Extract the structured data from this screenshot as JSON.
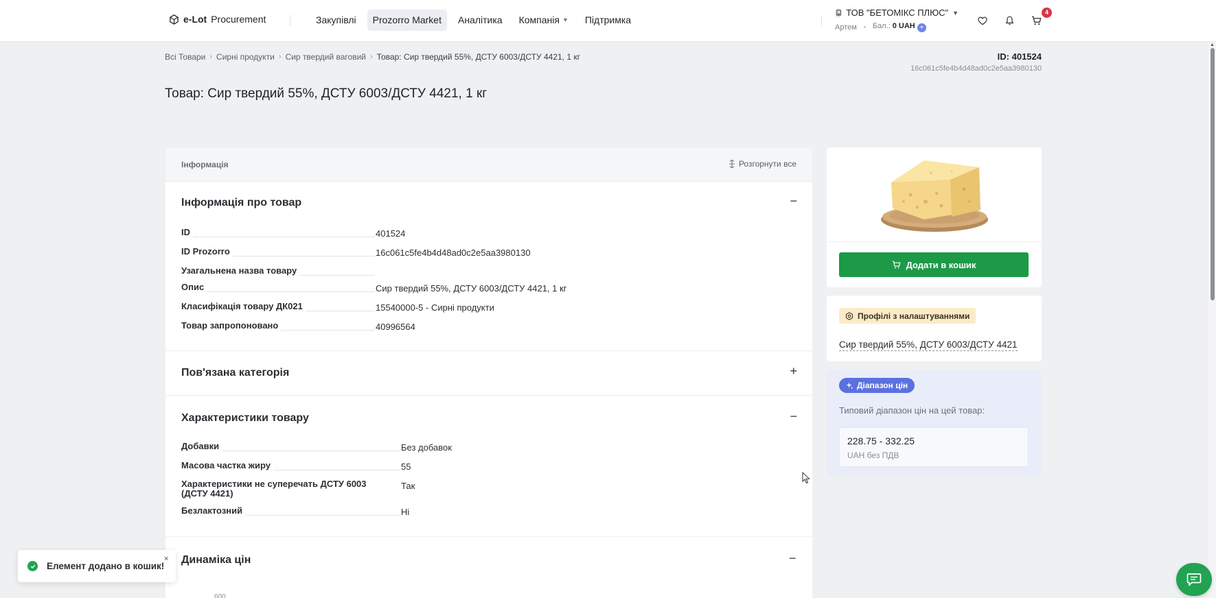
{
  "header": {
    "logo_brand": "e-Lot",
    "logo_sub": "Procurement",
    "nav": [
      {
        "label": "Закупівлі"
      },
      {
        "label": "Prozorro Market"
      },
      {
        "label": "Аналітика"
      },
      {
        "label": "Компанія"
      },
      {
        "label": "Підтримка"
      }
    ],
    "company_name": "ТОВ \"БЕТОМІКС ПЛЮС\"",
    "user_name": "Артем",
    "balance_label": "Бал.:",
    "balance_value": "0 UAH",
    "cart_count": "4"
  },
  "breadcrumb": {
    "items": [
      "Всі Товари",
      "Сирні продукти",
      "Сир твердий ваговий"
    ],
    "current": "Товар: Сир твердий 55%, ДСТУ 6003/ДСТУ 4421, 1 кг"
  },
  "product": {
    "id_label": "ID: 401524",
    "hash": "16c061c5fe4b4d48ad0c2e5aa3980130",
    "title": "Товар: Сир твердий 55%, ДСТУ 6003/ДСТУ 4421, 1 кг"
  },
  "panel": {
    "header_label": "Інформація",
    "expand_all": "Розгорнути все",
    "sections": {
      "info": {
        "title": "Інформація про товар",
        "toggle": "−",
        "rows": [
          {
            "key": "ID",
            "value": "401524"
          },
          {
            "key": "ID Prozorro",
            "value": "16c061c5fe4b4d48ad0c2e5aa3980130"
          },
          {
            "key": "Узагальнена назва товару",
            "value": ""
          },
          {
            "key": "Опис",
            "value": "Сир твердий 55%, ДСТУ 6003/ДСТУ 4421, 1 кг"
          },
          {
            "key": "Класифікація товару ДК021",
            "value": "15540000-5 - Сирні продукти"
          },
          {
            "key": "Товар запропоновано",
            "value": "40996564"
          }
        ]
      },
      "category": {
        "title": "Пов'язана категорія",
        "toggle": "+"
      },
      "specs": {
        "title": "Характеристики товару",
        "toggle": "−",
        "rows": [
          {
            "key": "Добавки",
            "value": "Без добавок"
          },
          {
            "key": "Масова частка жиру",
            "value": "55"
          },
          {
            "key": "Характеристики не суперечать ДСТУ 6003",
            "key2": "(ДСТУ 4421)",
            "value": "Так"
          },
          {
            "key": "Безлактозний",
            "value": "Ні"
          }
        ]
      },
      "prices": {
        "title": "Динаміка цін",
        "toggle": "−",
        "axis_top": "600"
      }
    }
  },
  "side": {
    "add_to_cart": "Додати в кошик",
    "profile_badge": "Профілі з налаштуваннями",
    "profile_link": "Сир твердий 55%, ДСТУ 6003/ДСТУ 4421",
    "price_badge": "Діапазон цін",
    "price_desc": "Типовий діапазон цін на цей товар:",
    "price_range": "228.75 - 332.25",
    "price_unit": "UAH без ПДВ"
  },
  "toast": {
    "message": "Елемент додано в кошик!",
    "close": "×"
  },
  "colors": {
    "primary_green": "#1c9a48",
    "accent_blue": "#5b71de",
    "badge_red": "#d6364a"
  }
}
